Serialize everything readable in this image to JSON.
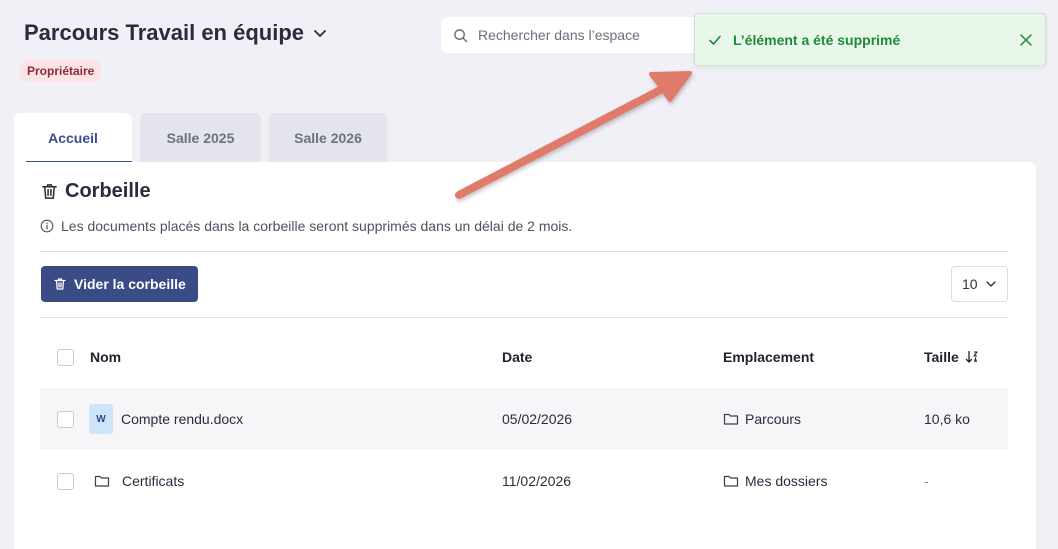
{
  "header": {
    "space_title": "Parcours Travail en équipe",
    "role_badge": "Propriétaire",
    "search_placeholder": "Rechercher dans l’espace"
  },
  "toast": {
    "message": "L’élément a été supprimé",
    "color": "#1f8a3a"
  },
  "tabs": [
    {
      "label": "Accueil",
      "active": true
    },
    {
      "label": "Salle 2025",
      "active": false
    },
    {
      "label": "Salle 2026",
      "active": false
    }
  ],
  "panel": {
    "title": "Corbeille",
    "info": "Les documents placés dans la corbeille seront supprimés dans un délai de 2 mois.",
    "empty_button": "Vider la corbeille",
    "page_size": "10"
  },
  "table": {
    "columns": {
      "name": "Nom",
      "date": "Date",
      "location": "Emplacement",
      "size": "Taille"
    },
    "rows": [
      {
        "icon": "word-file-icon",
        "icon_label": "W",
        "name": "Compte rendu.docx",
        "date": "05/02/2026",
        "location": "Parcours",
        "size": "10,6 ko"
      },
      {
        "icon": "folder-icon",
        "name": "Certificats",
        "date": "11/02/2026",
        "location": "Mes dossiers",
        "size": "-"
      }
    ]
  },
  "colors": {
    "accent": "#3b4b86",
    "badge_bg": "#fbe3e6",
    "toast_bg": "#e8f7ea",
    "arrow": "#e07a6a"
  }
}
